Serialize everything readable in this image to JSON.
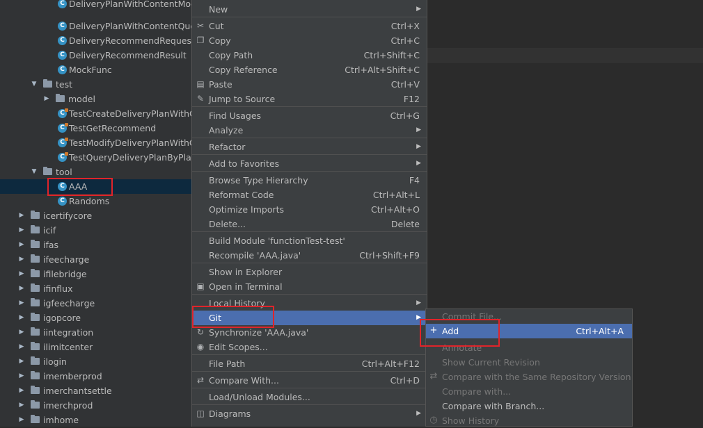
{
  "tree": {
    "items": [
      {
        "label": "DeliveryPlanWithContentModif",
        "kind": "class"
      },
      {
        "label": "DeliveryPlanWithContentQuery",
        "kind": "class"
      },
      {
        "label": "DeliveryRecommendRequest",
        "kind": "class"
      },
      {
        "label": "DeliveryRecommendResult",
        "kind": "class"
      },
      {
        "label": "MockFunc",
        "kind": "class"
      },
      {
        "label": "test",
        "kind": "folder-open"
      },
      {
        "label": "model",
        "kind": "folder-closed"
      },
      {
        "label": "TestCreateDeliveryPlanWithCo",
        "kind": "test"
      },
      {
        "label": "TestGetRecommend",
        "kind": "test"
      },
      {
        "label": "TestModifyDeliveryPlanWithCo",
        "kind": "test"
      },
      {
        "label": "TestQueryDeliveryPlanByPlanIc",
        "kind": "test"
      },
      {
        "label": "tool",
        "kind": "folder-open"
      },
      {
        "label": "AAA",
        "kind": "class",
        "selected": true
      },
      {
        "label": "Randoms",
        "kind": "class"
      },
      {
        "label": "icertifycore",
        "kind": "module"
      },
      {
        "label": "icif",
        "kind": "module"
      },
      {
        "label": "ifas",
        "kind": "module"
      },
      {
        "label": "ifeecharge",
        "kind": "module"
      },
      {
        "label": "ifilebridge",
        "kind": "module"
      },
      {
        "label": "ifinflux",
        "kind": "module"
      },
      {
        "label": "igfeecharge",
        "kind": "module"
      },
      {
        "label": "igopcore",
        "kind": "module"
      },
      {
        "label": "iintegration",
        "kind": "module"
      },
      {
        "label": "ilimitcenter",
        "kind": "module"
      },
      {
        "label": "ilogin",
        "kind": "module"
      },
      {
        "label": "imemberprod",
        "kind": "module"
      },
      {
        "label": "imerchantsettle",
        "kind": "module"
      },
      {
        "label": "imerchprod",
        "kind": "module"
      },
      {
        "label": "imhome",
        "kind": "module"
      }
    ]
  },
  "menu": {
    "items": [
      {
        "label": "New",
        "submenu": true
      },
      {
        "label": "Cut",
        "shortcut": "Ctrl+X",
        "icon": "cut-icon"
      },
      {
        "label": "Copy",
        "shortcut": "Ctrl+C",
        "icon": "copy-icon"
      },
      {
        "label": "Copy Path",
        "shortcut": "Ctrl+Shift+C"
      },
      {
        "label": "Copy Reference",
        "shortcut": "Ctrl+Alt+Shift+C"
      },
      {
        "label": "Paste",
        "shortcut": "Ctrl+V",
        "icon": "paste-icon"
      },
      {
        "label": "Jump to Source",
        "shortcut": "F12",
        "icon": "edit-pencil-icon"
      },
      {
        "label": "Find Usages",
        "shortcut": "Ctrl+G"
      },
      {
        "label": "Analyze",
        "submenu": true
      },
      {
        "label": "Refactor",
        "submenu": true
      },
      {
        "label": "Add to Favorites",
        "submenu": true
      },
      {
        "label": "Browse Type Hierarchy",
        "shortcut": "F4"
      },
      {
        "label": "Reformat Code",
        "shortcut": "Ctrl+Alt+L"
      },
      {
        "label": "Optimize Imports",
        "shortcut": "Ctrl+Alt+O"
      },
      {
        "label": "Delete...",
        "shortcut": "Delete"
      },
      {
        "label": "Build Module 'functionTest-test'"
      },
      {
        "label": "Recompile 'AAA.java'",
        "shortcut": "Ctrl+Shift+F9"
      },
      {
        "label": "Show in Explorer"
      },
      {
        "label": "Open in Terminal",
        "icon": "terminal-icon"
      },
      {
        "label": "Local History",
        "submenu": true
      },
      {
        "label": "Git",
        "submenu": true,
        "highlighted": true
      },
      {
        "label": "Synchronize 'AAA.java'",
        "icon": "sync-icon"
      },
      {
        "label": "Edit Scopes...",
        "icon": "scope-icon"
      },
      {
        "label": "File Path",
        "shortcut": "Ctrl+Alt+F12"
      },
      {
        "label": "Compare With...",
        "shortcut": "Ctrl+D",
        "icon": "compare-icon"
      },
      {
        "label": "Load/Unload Modules..."
      },
      {
        "label": "Diagrams",
        "submenu": true,
        "icon": "diagram-icon"
      }
    ]
  },
  "git_submenu": {
    "items": [
      {
        "label": "Commit File...",
        "enabled": false
      },
      {
        "label": "Add",
        "shortcut": "Ctrl+Alt+A",
        "icon": "plus-icon",
        "highlighted": true
      },
      {
        "label": "Annotate",
        "enabled": false
      },
      {
        "label": "Show Current Revision",
        "enabled": false
      },
      {
        "label": "Compare with the Same Repository Version",
        "enabled": false,
        "icon": "compare-icon"
      },
      {
        "label": "Compare with...",
        "enabled": false
      },
      {
        "label": "Compare with Branch...",
        "enabled": true
      },
      {
        "label": "Show History",
        "enabled": false,
        "icon": "history-icon"
      }
    ]
  },
  "icons": {
    "cut-icon": "✂",
    "copy-icon": "❐",
    "paste-icon": "▤",
    "edit-pencil-icon": "✎",
    "terminal-icon": "▣",
    "sync-icon": "↻",
    "scope-icon": "◉",
    "compare-icon": "⇄",
    "diagram-icon": "◫",
    "plus-icon": "+",
    "history-icon": "◷"
  },
  "colors": {
    "highlight": "#4b6eaf",
    "annotation": "#e0242a",
    "class_icon": "#3592c4"
  }
}
